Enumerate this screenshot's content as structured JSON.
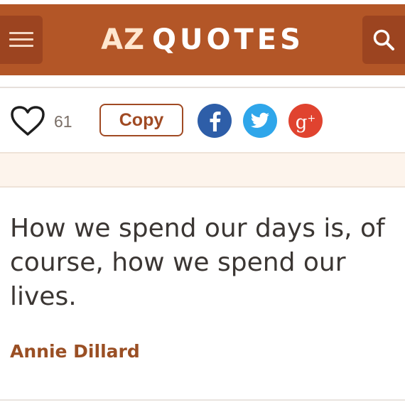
{
  "header": {
    "logo_az": "AZ",
    "logo_quotes": "QUOTES",
    "background_color": "#b35627",
    "menu_icon": "hamburger-menu-icon",
    "search_icon": "search-icon"
  },
  "actions": {
    "like_count": "61",
    "copy_label": "Copy",
    "social": [
      "facebook-icon",
      "twitter-icon",
      "google-plus-icon"
    ]
  },
  "quote": {
    "text": "How we spend our days is, of course, how we spend our lives.",
    "author": "Annie Dillard"
  }
}
